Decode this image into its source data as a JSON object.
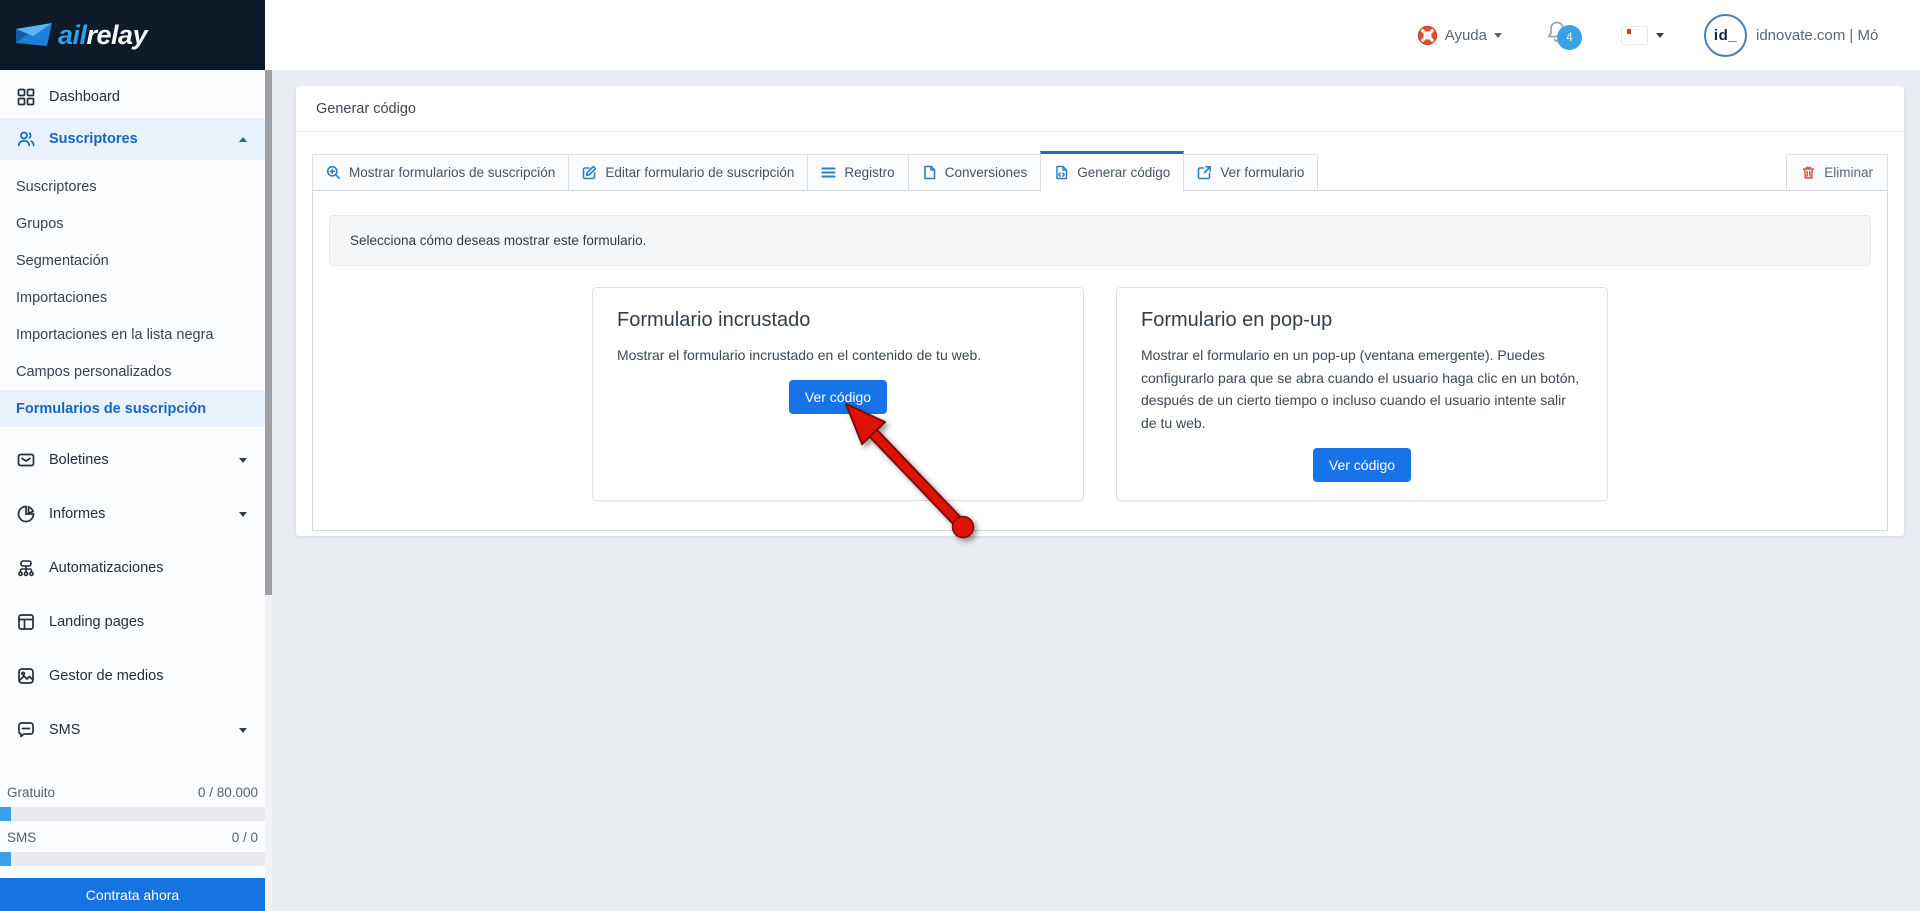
{
  "brand": {
    "logo_ail": "ail",
    "logo_relay": "relay"
  },
  "topbar": {
    "help_label": "Ayuda",
    "notification_count": "4",
    "avatar_text": "id_",
    "account_name": "idnovate.com | Mó"
  },
  "sidebar": {
    "items": {
      "dashboard": "Dashboard",
      "suscriptores": "Suscriptores",
      "boletines": "Boletines",
      "informes": "Informes",
      "automatizaciones": "Automatizaciones",
      "landing_pages": "Landing pages",
      "gestor_medios": "Gestor de medios",
      "sms": "SMS"
    },
    "suscriptores_children": [
      "Suscriptores",
      "Grupos",
      "Segmentación",
      "Importaciones",
      "Importaciones en la lista negra",
      "Campos personalizados",
      "Formularios de suscripción"
    ],
    "usage": {
      "free_label": "Gratuito",
      "free_value": "0 / 80.000",
      "sms_label": "SMS",
      "sms_value": "0 / 0",
      "cta": "Contrata ahora"
    }
  },
  "main": {
    "page_title": "Generar código",
    "tabs": [
      {
        "label": "Mostrar formularios de suscripción"
      },
      {
        "label": "Editar formulario de suscripción"
      },
      {
        "label": "Registro"
      },
      {
        "label": "Conversiones"
      },
      {
        "label": "Generar código"
      },
      {
        "label": "Ver formulario"
      }
    ],
    "active_tab": "Generar código",
    "delete_button": "Eliminar",
    "alert": "Selecciona cómo deseas mostrar este formulario.",
    "cards": [
      {
        "title": "Formulario incrustado",
        "description": "Mostrar el formulario incrustado en el contenido de tu web.",
        "button": "Ver código"
      },
      {
        "title": "Formulario en pop-up",
        "description": "Mostrar el formulario en un pop-up (ventana emergente). Puedes configurarlo para que se abra cuando el usuario haga clic en un botón, después de un cierto tiempo o incluso cuando el usuario intente salir de tu web.",
        "button": "Ver código"
      }
    ]
  },
  "colors": {
    "accent_blue": "#1674e8",
    "badge_blue": "#3aa0e8",
    "navy": "#0d1a27",
    "danger_red": "#dd5252",
    "arrow_red": "#e01208"
  }
}
